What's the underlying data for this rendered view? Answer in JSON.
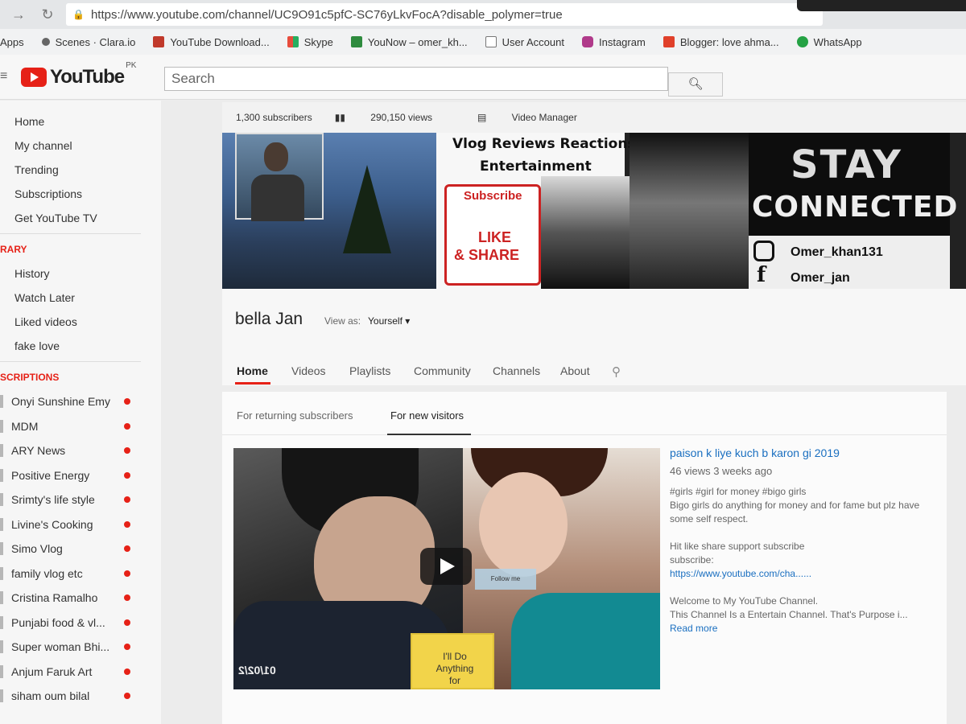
{
  "browser": {
    "url": "https://www.youtube.com/channel/UC9O91c5pfC-SC76yLkvFocA?disable_polymer=true",
    "bookmarks": [
      "Apps",
      "Scenes · Clara.io",
      "YouTube Download...",
      "Skype",
      "YouNow – omer_kh...",
      "User Account",
      "Instagram",
      "Blogger: love ahma...",
      "WhatsApp"
    ]
  },
  "masthead": {
    "logo": "YouTube",
    "region": "PK",
    "search_placeholder": "Search"
  },
  "guide": {
    "main": [
      "Home",
      "My channel",
      "Trending",
      "Subscriptions",
      "Get YouTube TV"
    ],
    "library_title": "RARY",
    "library": [
      "History",
      "Watch Later",
      "Liked videos",
      "fake love"
    ],
    "subs_title": "SCRIPTIONS",
    "subscriptions": [
      "Onyi Sunshine Emy",
      "MDM",
      "ARY News",
      "Positive Energy",
      "Srimty's life style",
      "Livine's Cooking",
      "Simo Vlog",
      "family vlog etc",
      "Cristina Ramalho",
      "Punjabi food & vl...",
      "Super woman Bhi...",
      "Anjum Faruk Art",
      "siham oum bilal"
    ]
  },
  "stats": {
    "subscribers": "1,300 subscribers",
    "views": "290,150 views",
    "video_manager": "Video Manager"
  },
  "banner": {
    "line1": "Vlog Reviews Reactions",
    "line2": "Entertainment",
    "subscribe": "Subscribe",
    "like": "LIKE",
    "share": "& SHARE",
    "stay": "STAY",
    "connected": "CONNECTED",
    "handle1": "Omer_khan131",
    "handle2": "Omer_jan"
  },
  "channel": {
    "name": "bella Jan",
    "view_as_label": "View as:",
    "view_as_value": "Yourself ▾",
    "tabs": [
      "Home",
      "Videos",
      "Playlists",
      "Community",
      "Channels",
      "About"
    ]
  },
  "subtabs": [
    "For returning subscribers",
    "For new visitors"
  ],
  "video": {
    "title": "paison k liye kuch b karon gi 2019",
    "meta": "46 views  3 weeks ago",
    "desc1": "#girls #girl for money #bigo girls",
    "desc2": "Bigo girls do anything for money and for fame but plz have some self respect.",
    "desc3": "Hit like share support subscribe",
    "desc4": "subscribe:",
    "link": "https://www.youtube.com/cha......",
    "desc5": "Welcome to My YouTube Channel.",
    "desc6": "This Channel Is a Entertain Channel. That's Purpose i...",
    "read_more": "Read more",
    "thumb_stamp": "01/02/2",
    "thumb_card": "I'll Do Anything for",
    "thumb_follow": "Follow me"
  }
}
